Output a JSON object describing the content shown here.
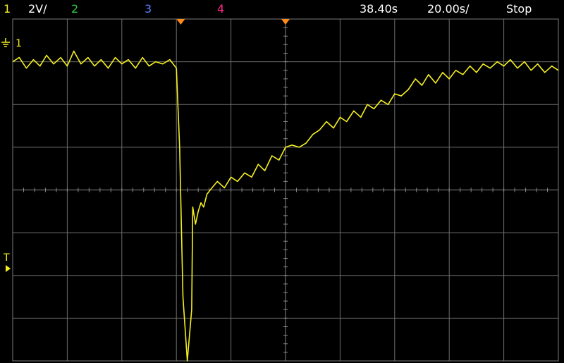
{
  "status_bar": {
    "channel1_label": "1",
    "channel1_scale": "2V/",
    "channel2_label": "2",
    "channel3_label": "3",
    "channel4_label": "4",
    "delay": "38.40s",
    "timebase": "20.00s/",
    "run_state": "Stop"
  },
  "markers": {
    "channel1_ground_label": "1",
    "trigger_label": "T"
  },
  "colors": {
    "channel1": "#f4ef1e",
    "channel2": "#2ecc40",
    "channel3": "#5a7dff",
    "channel4": "#ff2a8a",
    "trigger_marker": "#ff8c1a"
  },
  "chart_data": {
    "type": "line",
    "title": "",
    "xlabel": "",
    "ylabel": "",
    "x_unit": "div",
    "y_unit": "div",
    "xlim": [
      0,
      10
    ],
    "ylim": [
      0,
      8
    ],
    "grid": true,
    "series": [
      {
        "x": [
          0.0,
          0.12,
          0.25,
          0.38,
          0.5,
          0.62,
          0.75,
          0.88,
          1.0,
          1.12,
          1.25,
          1.38,
          1.5,
          1.62,
          1.75,
          1.88,
          2.0,
          2.12,
          2.25,
          2.38,
          2.5,
          2.62,
          2.75,
          2.88,
          3.0,
          3.06,
          3.12,
          3.2,
          3.28,
          3.3,
          3.35,
          3.4,
          3.45,
          3.5,
          3.56,
          3.62,
          3.75,
          3.88,
          4.0,
          4.12,
          4.25,
          4.38,
          4.5,
          4.62,
          4.75,
          4.88,
          5.0,
          5.12,
          5.25,
          5.38,
          5.5,
          5.62,
          5.75,
          5.88,
          6.0,
          6.12,
          6.25,
          6.38,
          6.5,
          6.62,
          6.75,
          6.88,
          7.0,
          7.12,
          7.25,
          7.38,
          7.5,
          7.62,
          7.75,
          7.88,
          8.0,
          8.12,
          8.25,
          8.38,
          8.5,
          8.62,
          8.75,
          8.88,
          9.0,
          9.12,
          9.25,
          9.38,
          9.5,
          9.62,
          9.75,
          9.88,
          10.0
        ],
        "values": [
          7.0,
          7.1,
          6.85,
          7.05,
          6.9,
          7.15,
          6.95,
          7.1,
          6.9,
          7.25,
          6.95,
          7.1,
          6.9,
          7.05,
          6.85,
          7.1,
          6.95,
          7.05,
          6.85,
          7.1,
          6.9,
          7.0,
          6.95,
          7.05,
          6.85,
          5.0,
          1.5,
          0.0,
          1.2,
          3.6,
          3.2,
          3.5,
          3.7,
          3.6,
          3.9,
          4.0,
          4.2,
          4.05,
          4.3,
          4.2,
          4.4,
          4.3,
          4.6,
          4.45,
          4.8,
          4.7,
          5.0,
          5.05,
          5.0,
          5.1,
          5.3,
          5.4,
          5.6,
          5.45,
          5.7,
          5.6,
          5.85,
          5.7,
          6.0,
          5.9,
          6.1,
          6.0,
          6.25,
          6.2,
          6.35,
          6.6,
          6.45,
          6.7,
          6.5,
          6.75,
          6.6,
          6.8,
          6.7,
          6.9,
          6.75,
          6.95,
          6.85,
          7.0,
          6.9,
          7.05,
          6.85,
          7.0,
          6.8,
          6.95,
          6.75,
          6.9,
          6.8
        ]
      }
    ]
  }
}
